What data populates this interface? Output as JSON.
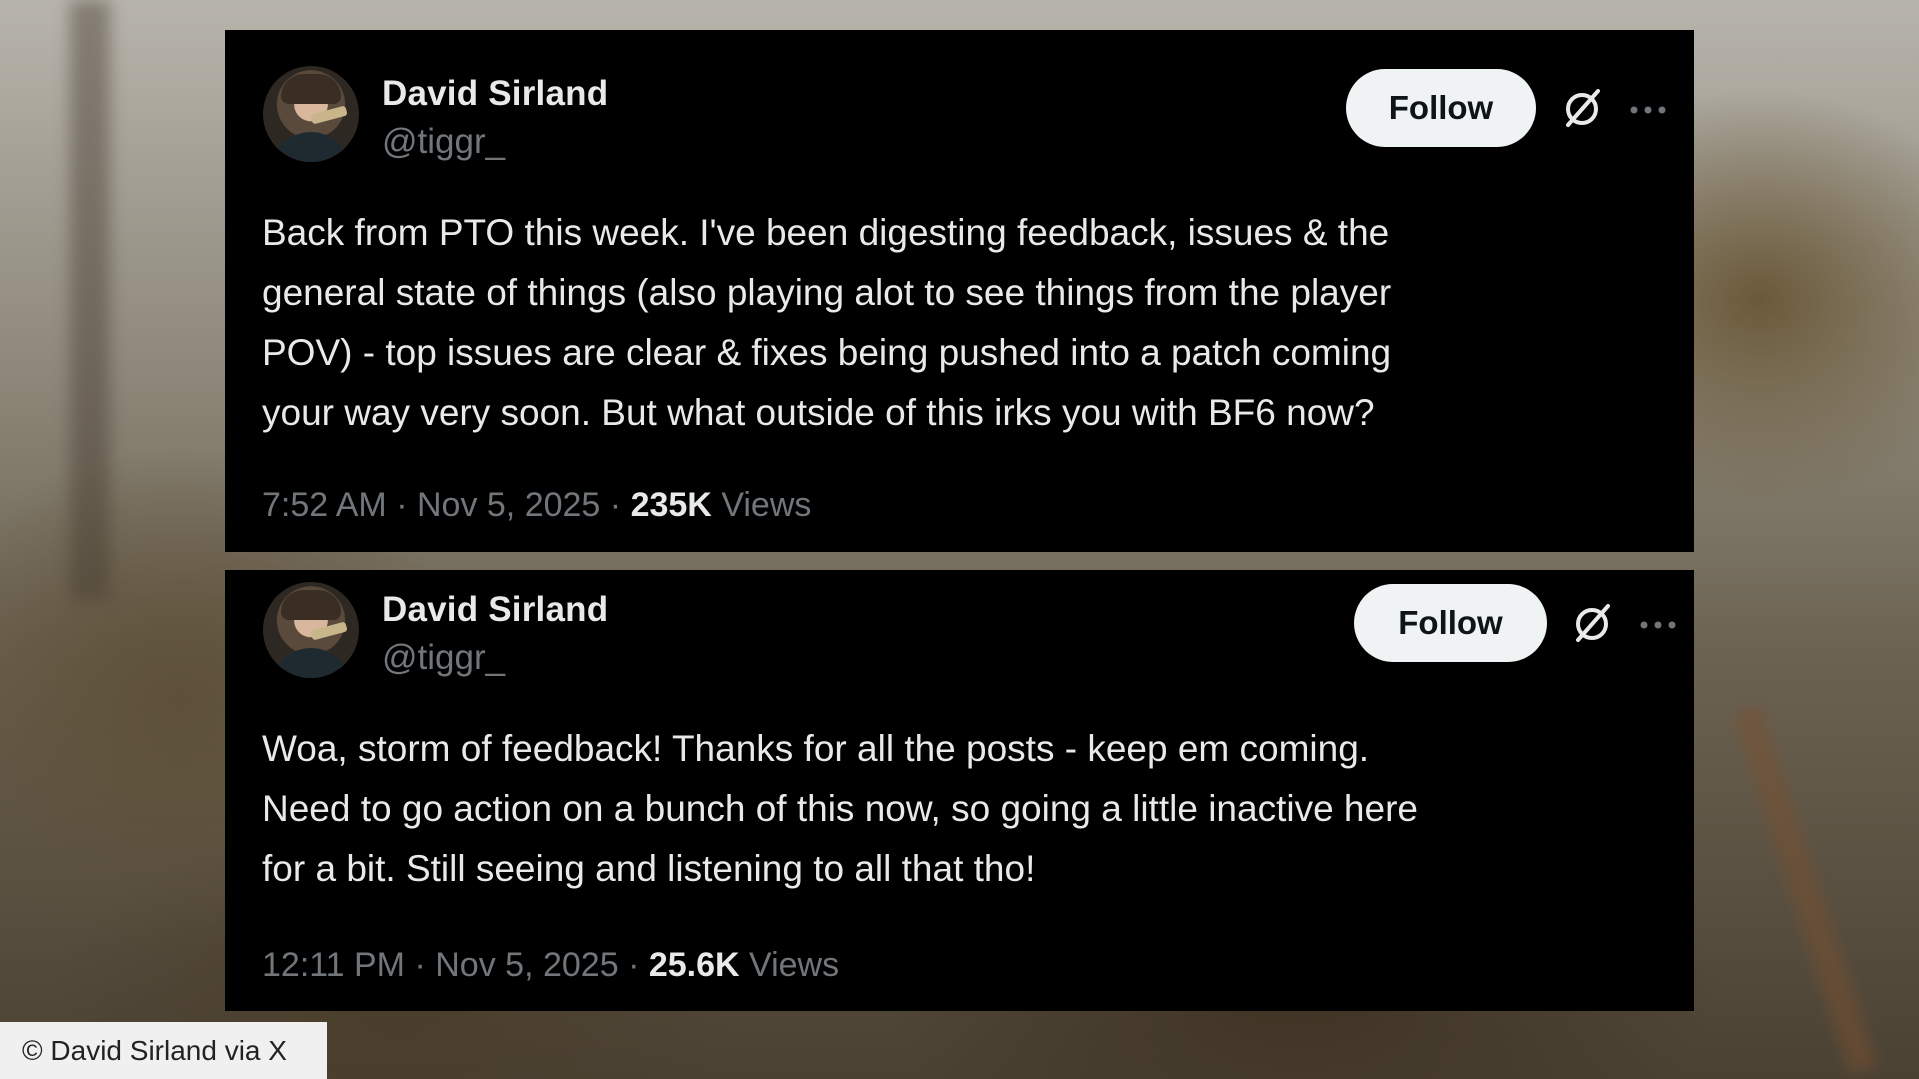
{
  "tweets": [
    {
      "author_name": "David Sirland",
      "handle": "@tiggr_",
      "follow_label": "Follow",
      "text": "Back from PTO this week. I've been digesting feedback, issues & the\ngeneral state of things (also playing alot to see things from the player\nPOV) - top issues are clear & fixes being pushed into a patch coming\nyour way very soon. But what outside of this irks you with BF6 now?",
      "time": "7:52 AM",
      "date": "Nov 5, 2025",
      "views_count": "235K",
      "views_label": "Views"
    },
    {
      "author_name": "David Sirland",
      "handle": "@tiggr_",
      "follow_label": "Follow",
      "text": "Woa, storm of feedback! Thanks for all the posts - keep em coming.\nNeed to go action on a bunch of this now, so going a little inactive here\nfor a bit. Still seeing and listening to all that tho!",
      "time": "12:11 PM",
      "date": "Nov 5, 2025",
      "views_count": "25.6K",
      "views_label": "Views"
    }
  ],
  "separator": "·",
  "credit": "© David Sirland via X",
  "icons": {
    "grok": "grok-icon",
    "more": "more-icon",
    "avatar": "avatar"
  },
  "colors": {
    "card_bg": "#000000",
    "text_primary": "#e7e9ea",
    "text_secondary": "#71767b",
    "follow_bg": "#eff3f4"
  }
}
